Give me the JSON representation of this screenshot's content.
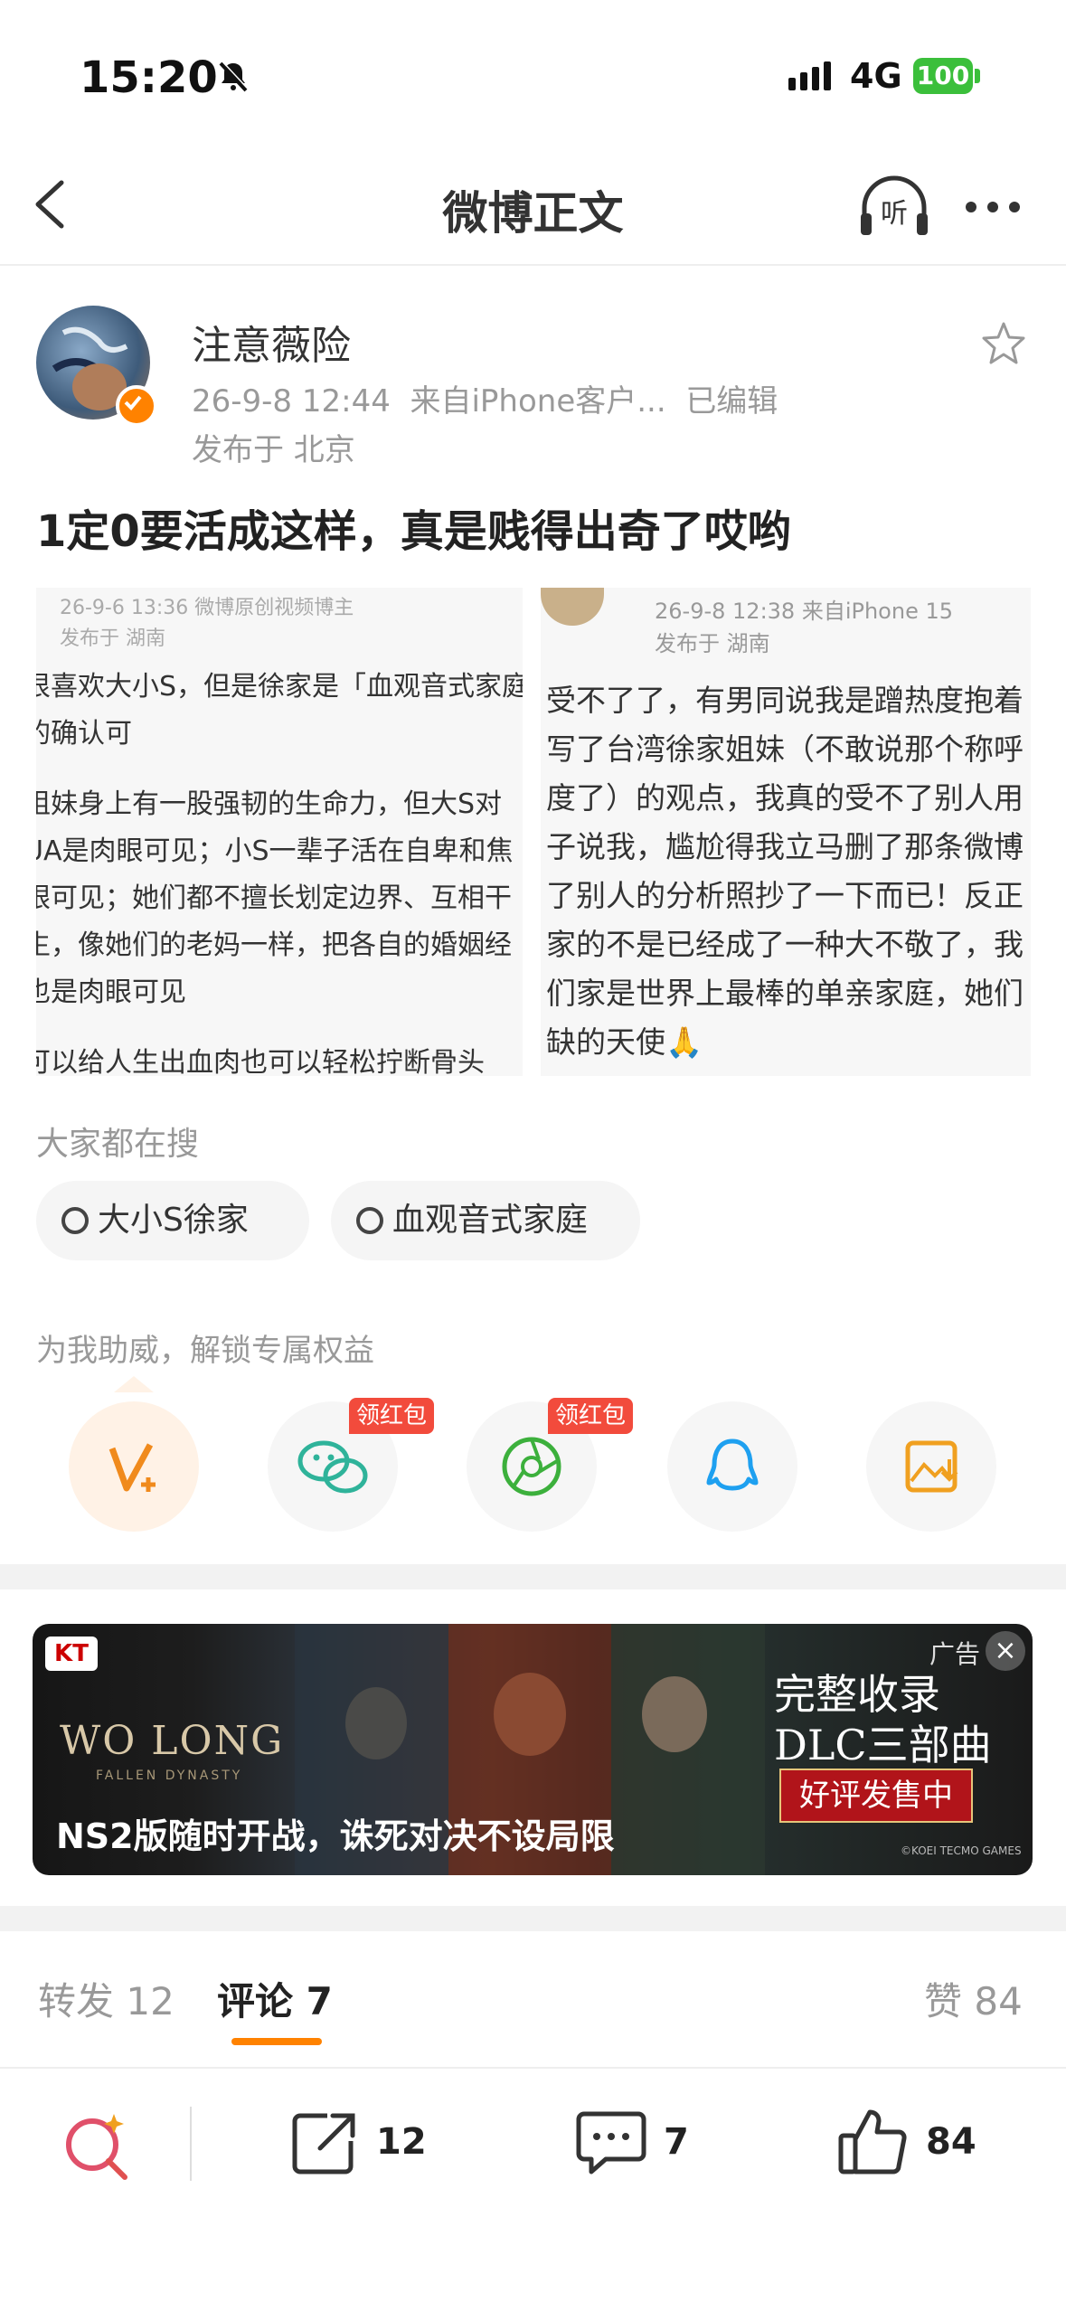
{
  "status_bar": {
    "time": "15:20",
    "network": "4G",
    "battery": "100"
  },
  "nav": {
    "title": "微博正文",
    "listen_label": "听"
  },
  "post": {
    "author": "注意薇险",
    "date": "26-9-8 12:44",
    "source": "来自iPhone客户...",
    "edited": "已编辑",
    "location": "发布于 北京",
    "text": "1定0要活成这样，真是贱得出奇了哎哟"
  },
  "screenshot_left": {
    "meta1": "26-9-6 13:36  微博原创视频博主",
    "meta2": "发布于 湖南",
    "lines": [
      "很喜欢大小S，但是徐家是「血观音式家庭",
      "的确认可",
      "",
      "姐妹身上有一股强韧的生命力，但大S对",
      "UA是肉眼可见；小S一辈子活在自卑和焦",
      "眼可见；她们都不擅长划定边界、互相干",
      "生，像她们的老妈一样，把各自的婚姻经",
      "也是肉眼可见",
      "",
      " 可以给人生出血肉也可以轻松拧断骨头"
    ]
  },
  "screenshot_right": {
    "meta1": "26-9-8 12:38  来自iPhone 15",
    "meta2": "发布于 湖南",
    "lines": [
      "受不了了，有男同说我是蹭热度抱着",
      "写了台湾徐家姐妹（不敢说那个称呼",
      "度了）的观点，我真的受不了别人用",
      "子说我，尴尬得我立马删了那条微博",
      "了别人的分析照抄了一下而已！反正",
      "家的不是已经成了一种大不敬了，我",
      "们家是世界上最棒的单亲家庭，她们",
      "缺的天使🙏"
    ]
  },
  "hot_search": {
    "label": "大家都在搜",
    "chips": [
      "大小S徐家",
      "血观音式家庭"
    ]
  },
  "support": {
    "label": "为我助威，解锁专属权益",
    "red_tag": "领红包"
  },
  "ad": {
    "kt": "KT",
    "logo": "WO LONG",
    "logo_sub": "FALLEN DYNASTY",
    "tag": "广告",
    "right_line1": "完整收录",
    "right_line2": "DLC三部曲",
    "button": "好评发售中",
    "caption": "NS2版随时开战，诛死对决不设局限",
    "copyright": "©KOEI TECMO GAMES"
  },
  "tabs": {
    "repost_label": "转发",
    "repost_count": "12",
    "comment_label": "评论",
    "comment_count": "7",
    "like_label": "赞",
    "like_count": "84"
  },
  "bottom_bar": {
    "share_count": "12",
    "comment_count": "7",
    "like_count": "84"
  },
  "colors": {
    "accent": "#ff8200",
    "red": "#f24b3c"
  }
}
